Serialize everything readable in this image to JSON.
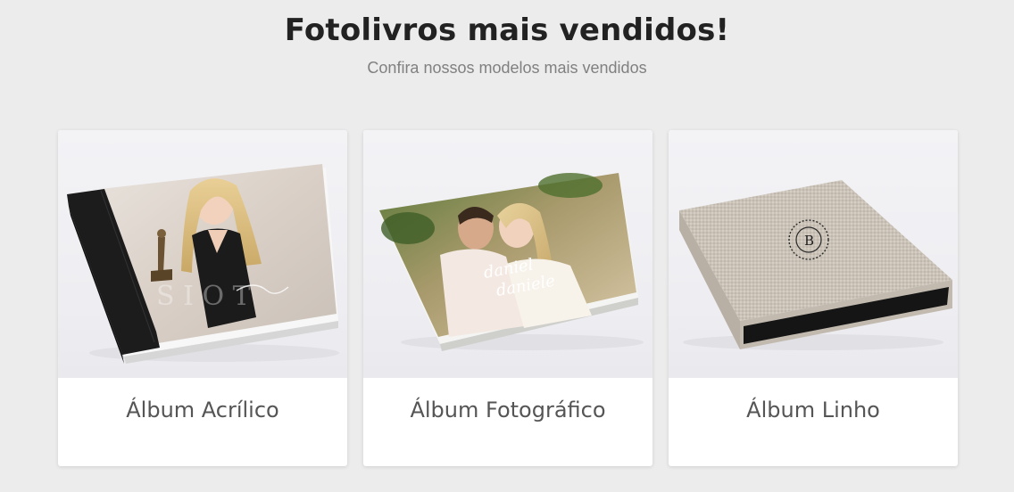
{
  "section": {
    "title": "Fotolivros mais vendidos!",
    "subtitle": "Confira nossos modelos mais vendidos"
  },
  "products": [
    {
      "label": "Álbum Acrílico",
      "image": "acrylic-album-photo"
    },
    {
      "label": "Álbum Fotográfico",
      "image": "photo-album-photo"
    },
    {
      "label": "Álbum Linho",
      "image": "linen-album-photo"
    }
  ],
  "colors": {
    "page_background": "#ececec",
    "card_background": "#ffffff",
    "title_text": "#222222",
    "subtitle_text": "#808080",
    "card_label_text": "#555555"
  }
}
